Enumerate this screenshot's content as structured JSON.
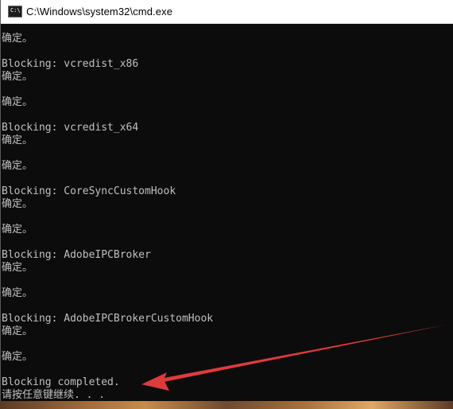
{
  "window": {
    "title": "C:\\Windows\\system32\\cmd.exe",
    "icon": "cmd-icon",
    "icon_glyph": "C:\\"
  },
  "console": {
    "lines": [
      "确定。",
      "",
      "Blocking: vcredist_x86",
      "确定。",
      "",
      "确定。",
      "",
      "Blocking: vcredist_x64",
      "确定。",
      "",
      "确定。",
      "",
      "Blocking: CoreSyncCustomHook",
      "确定。",
      "",
      "确定。",
      "",
      "Blocking: AdobeIPCBroker",
      "确定。",
      "",
      "确定。",
      "",
      "Blocking: AdobeIPCBrokerCustomHook",
      "确定。",
      "",
      "确定。",
      "",
      "Blocking completed.",
      "请按任意键继续. . ."
    ]
  },
  "annotation": {
    "arrow_color": "#e03b3b",
    "points_to": "Blocking completed."
  }
}
